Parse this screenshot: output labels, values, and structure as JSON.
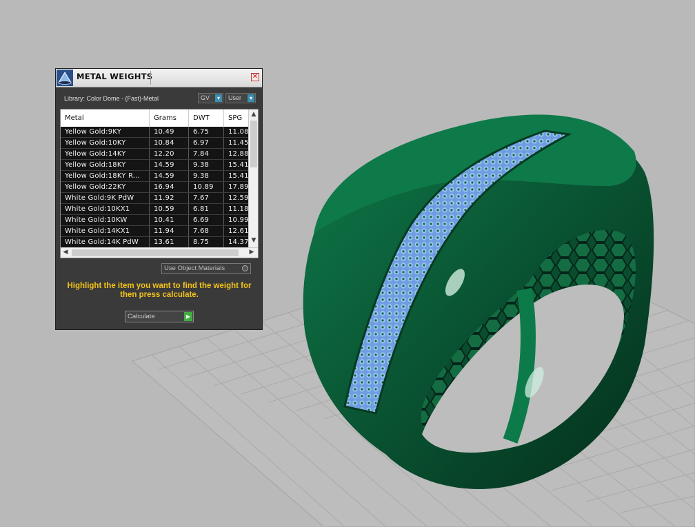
{
  "panel": {
    "title": "METAL WEIGHTS",
    "close_glyph": "✕",
    "library_label": "Library: Color Dome - (Fast)-Metal",
    "gv_select": "GV",
    "user_select": "User",
    "use_object_materials": "Use Object Materials",
    "instruction": "Highlight the item you want to find the weight for then press calculate.",
    "calculate_label": "Calculate"
  },
  "table": {
    "columns": [
      "Metal",
      "Grams",
      "DWT",
      "SPG"
    ],
    "rows": [
      [
        "Yellow Gold:9KY",
        "10.49",
        "6.75",
        "11.08"
      ],
      [
        "Yellow Gold:10KY",
        "10.84",
        "6.97",
        "11.45"
      ],
      [
        "Yellow Gold:14KY",
        "12.20",
        "7.84",
        "12.88"
      ],
      [
        "Yellow Gold:18KY",
        "14.59",
        "9.38",
        "15.41"
      ],
      [
        "Yellow Gold:18KY R...",
        "14.59",
        "9.38",
        "15.41"
      ],
      [
        "Yellow Gold:22KY",
        "16.94",
        "10.89",
        "17.89"
      ],
      [
        "White Gold:9K PdW",
        "11.92",
        "7.67",
        "12.59"
      ],
      [
        "White Gold:10KX1",
        "10.59",
        "6.81",
        "11.18"
      ],
      [
        "White Gold:10KW",
        "10.41",
        "6.69",
        "10.99"
      ],
      [
        "White Gold:14KX1",
        "11.94",
        "7.68",
        "12.61"
      ],
      [
        "White Gold:14K PdW",
        "13.61",
        "8.75",
        "14.37"
      ]
    ]
  },
  "icons": {
    "logo": "dome-logo-icon",
    "close": "close-icon",
    "scroll_up": "chevron-up-icon",
    "scroll_down": "chevron-down-icon",
    "scroll_left": "chevron-left-icon",
    "scroll_right": "chevron-right-icon",
    "calculate": "play-arrow-icon"
  },
  "colors": {
    "ring": "#0a6a40",
    "stones": "#8fb8f0",
    "instruction": "#f2c21a",
    "panel_bg": "#3a3a3a",
    "viewport_bg": "#b9b9b9"
  }
}
